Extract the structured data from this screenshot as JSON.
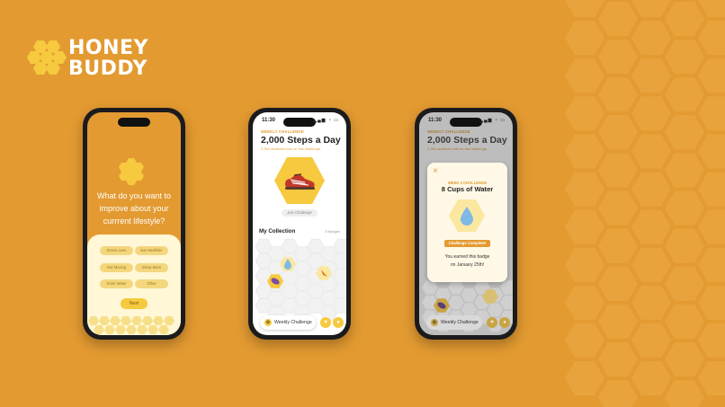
{
  "brand": {
    "line1": "HONEY",
    "line2": "BUDDY"
  },
  "colors": {
    "background": "#e39a31",
    "honey": "#f6c93f",
    "pale": "#fff1b8",
    "accent": "#e09a2f"
  },
  "phone1": {
    "question": [
      "What do you want to",
      "improve about your",
      "currrent lifestyle?"
    ],
    "options": [
      "Stress Less",
      "Eat Healthier",
      "Get Moving",
      "Sleep More",
      "Drink Water",
      "Other"
    ],
    "next_label": "Next"
  },
  "phone2": {
    "time": "11:30",
    "eyebrow": "WEEKLY CHALLENGE",
    "title": "2,000 Steps a Day",
    "subtitle": "2,354 students took on this challenge.",
    "join_label": "Join Challenge",
    "collection_title": "My Collection",
    "badge_count": "3 Badges",
    "nav_label": "Weekly Challenge"
  },
  "phone3": {
    "time": "11:30",
    "eyebrow": "WEEKLY CHALLENGE",
    "title": "2,000 Steps a Day",
    "subtitle": "2,354 students took on this challenge.",
    "modal": {
      "close": "×",
      "eyebrow": "WEEK 4 CHALLENGE",
      "title": "8 Cups of Water",
      "status": "Challenge Complete!",
      "message1": "You earned this badge",
      "message2": "on January 25th!"
    },
    "nav_label": "Weekly Challenge"
  },
  "icons": [
    "honeycomb-logo-icon",
    "shoe-icon",
    "water-drop-icon",
    "sleep-badge-icon",
    "carrot-icon",
    "bee-icon",
    "heart-icon",
    "profile-icon",
    "close-icon"
  ]
}
